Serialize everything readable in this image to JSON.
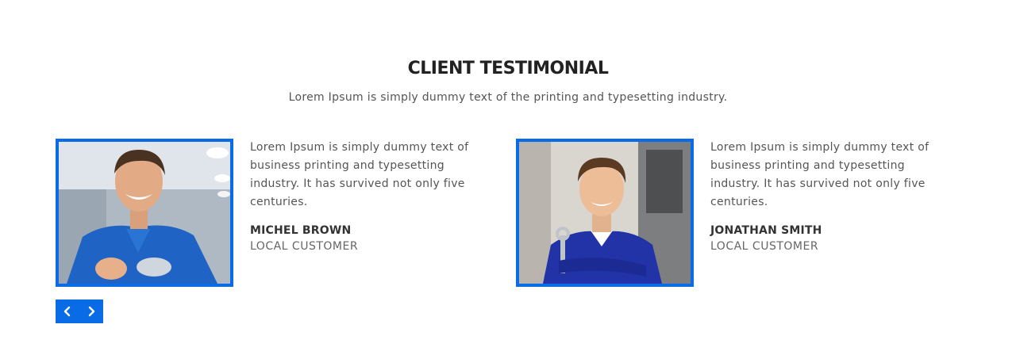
{
  "section": {
    "title": "CLIENT TESTIMONIAL",
    "subtitle": "Lorem Ipsum is simply dummy text of the printing and typesetting industry."
  },
  "testimonials": [
    {
      "quote": "Lorem Ipsum is simply dummy text of business printing and typesetting industry. It has survived not only five centuries.",
      "name": "MICHEL BROWN",
      "role": "LOCAL CUSTOMER"
    },
    {
      "quote": "Lorem Ipsum is simply dummy text of business printing and typesetting industry. It has survived not only five centuries.",
      "name": "JONATHAN SMITH",
      "role": "LOCAL CUSTOMER"
    }
  ],
  "carousel": {
    "prev_icon": "chevron-left-icon",
    "next_icon": "chevron-right-icon"
  },
  "colors": {
    "accent": "#0a6be6",
    "heading": "#222222",
    "body_text": "#555555",
    "background": "#ffffff"
  }
}
